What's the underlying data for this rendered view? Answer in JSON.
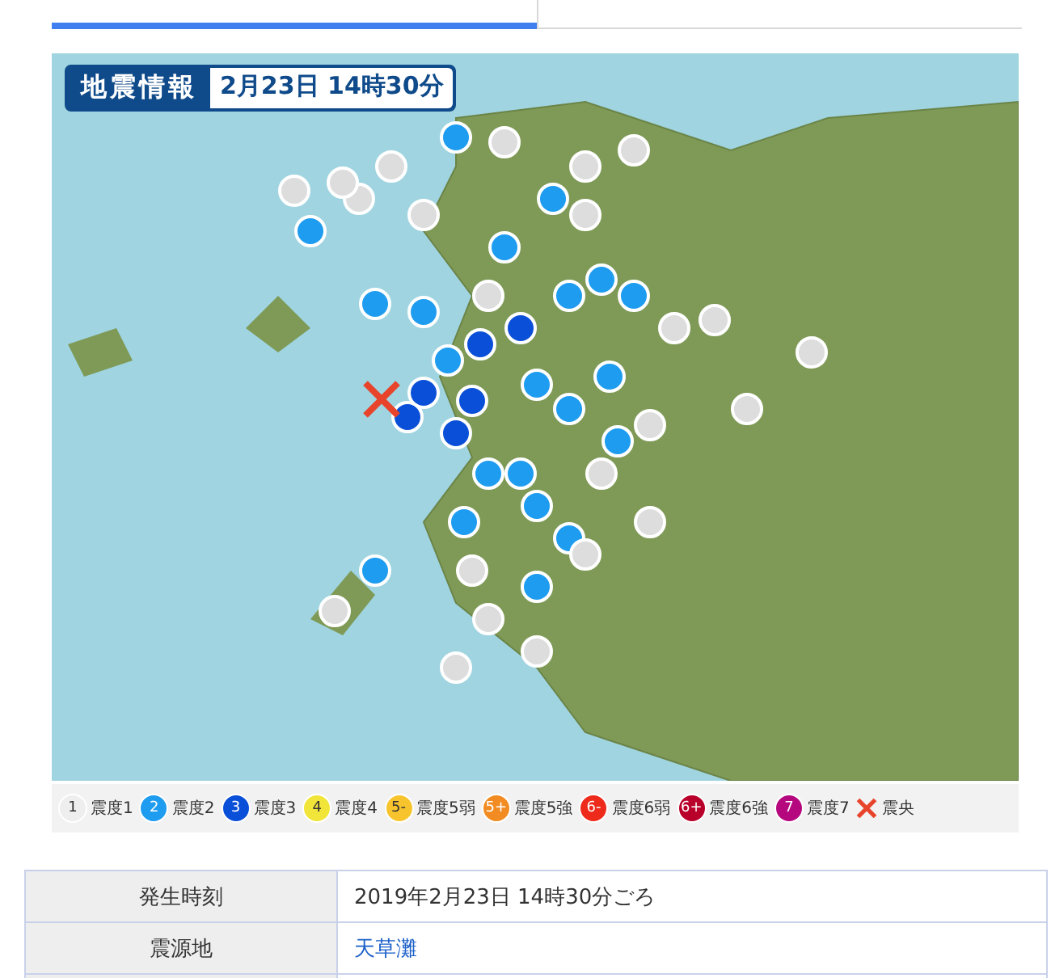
{
  "tabs": [
    {
      "selected": true
    },
    {
      "selected": false
    }
  ],
  "map": {
    "title": "地震情報",
    "date": "2月23日 14時30分"
  },
  "legend": [
    {
      "kind": "circle",
      "symbol": "1",
      "label": "震度1",
      "color": "#eeeeee"
    },
    {
      "kind": "circle",
      "symbol": "2",
      "label": "震度2",
      "color": "#1e9cf0"
    },
    {
      "kind": "circle",
      "symbol": "3",
      "label": "震度3",
      "color": "#0a4fd8"
    },
    {
      "kind": "circle",
      "symbol": "4",
      "label": "震度4",
      "color": "#f2e53a"
    },
    {
      "kind": "circle",
      "symbol": "5-",
      "label": "震度5弱",
      "color": "#f7c42d"
    },
    {
      "kind": "circle",
      "symbol": "5+",
      "label": "震度5強",
      "color": "#f28c22"
    },
    {
      "kind": "circle",
      "symbol": "6-",
      "label": "震度6弱",
      "color": "#ee2a1a"
    },
    {
      "kind": "circle",
      "symbol": "6+",
      "label": "震度6強",
      "color": "#b8002a"
    },
    {
      "kind": "circle",
      "symbol": "7",
      "label": "震度7",
      "color": "#b5087e"
    },
    {
      "kind": "cross",
      "label": "震央",
      "color": "#e8442c"
    }
  ],
  "table": {
    "rows": [
      {
        "label": "発生時刻",
        "value": "2019年2月23日 14時30分ごろ",
        "kind": "text"
      },
      {
        "label": "震源地",
        "value": "天草灘",
        "kind": "link"
      },
      {
        "kind": "empty"
      }
    ]
  }
}
